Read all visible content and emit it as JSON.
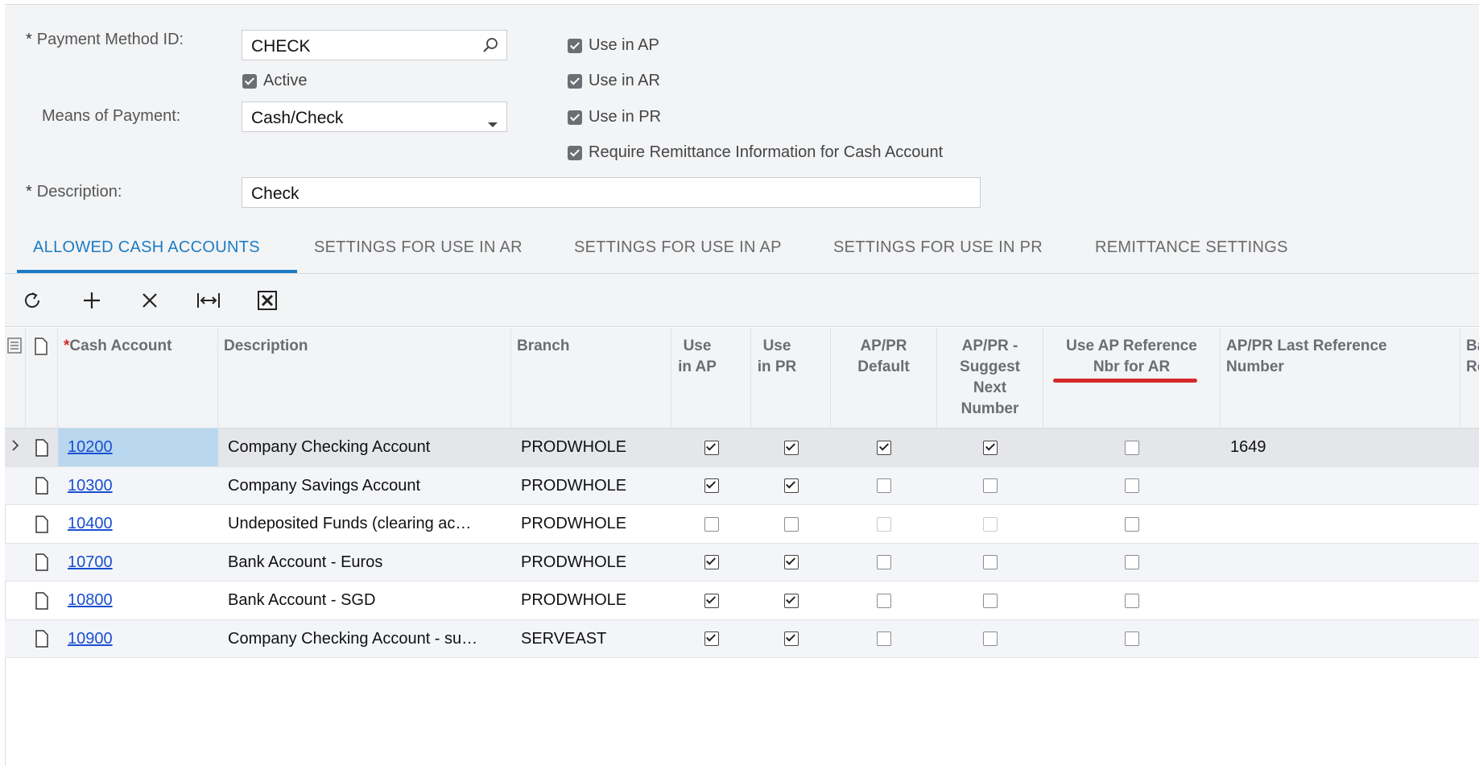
{
  "form": {
    "payment_method_label": "Payment Method ID:",
    "payment_method_value": "CHECK",
    "active_label": "Active",
    "means_label": "Means of Payment:",
    "means_value": "Cash/Check",
    "description_label": "Description:",
    "description_value": "Check",
    "required_mark": "*",
    "checkboxes": [
      {
        "label": "Use in AP",
        "checked": true
      },
      {
        "label": "Use in AR",
        "checked": true
      },
      {
        "label": "Use in PR",
        "checked": true
      },
      {
        "label": "Require Remittance Information for Cash Account",
        "checked": true
      }
    ]
  },
  "tabs": [
    {
      "label": "ALLOWED CASH ACCOUNTS",
      "active": true
    },
    {
      "label": "SETTINGS FOR USE IN AR",
      "active": false
    },
    {
      "label": "SETTINGS FOR USE IN AP",
      "active": false
    },
    {
      "label": "SETTINGS FOR USE IN PR",
      "active": false
    },
    {
      "label": "REMITTANCE SETTINGS",
      "active": false
    }
  ],
  "toolbar": [
    "refresh-icon",
    "add-icon",
    "delete-icon",
    "fit-columns-icon",
    "excel-export-icon"
  ],
  "grid": {
    "headers": {
      "cash_account": "Cash Account",
      "description": "Description",
      "branch": "Branch",
      "use_ap": "Use in AP",
      "use_pr": "Use in PR",
      "appr_default": "AP/PR Default",
      "appr_suggest": "AP/PR - Suggest Next Number",
      "use_ap_ref": "Use AP Reference Nbr for AR",
      "last_ref": "AP/PR Last Reference Number",
      "next_col": "Ba Re"
    },
    "rows": [
      {
        "account": "10200",
        "description": "Company Checking Account",
        "branch": "PRODWHOLE",
        "use_ap": "on",
        "use_pr": "on",
        "default": "on",
        "suggest": "on",
        "use_ap_ref": "off",
        "last_ref": "1649"
      },
      {
        "account": "10300",
        "description": "Company Savings Account",
        "branch": "PRODWHOLE",
        "use_ap": "on",
        "use_pr": "on",
        "default": "off",
        "suggest": "off",
        "use_ap_ref": "off",
        "last_ref": ""
      },
      {
        "account": "10400",
        "description": "Undeposited Funds (clearing ac…",
        "branch": "PRODWHOLE",
        "use_ap": "off",
        "use_pr": "off",
        "default": "dis",
        "suggest": "dis",
        "use_ap_ref": "off",
        "last_ref": ""
      },
      {
        "account": "10700",
        "description": "Bank Account - Euros",
        "branch": "PRODWHOLE",
        "use_ap": "on",
        "use_pr": "on",
        "default": "off",
        "suggest": "off",
        "use_ap_ref": "off",
        "last_ref": ""
      },
      {
        "account": "10800",
        "description": "Bank Account - SGD",
        "branch": "PRODWHOLE",
        "use_ap": "on",
        "use_pr": "on",
        "default": "off",
        "suggest": "off",
        "use_ap_ref": "off",
        "last_ref": ""
      },
      {
        "account": "10900",
        "description": "Company Checking Account - su…",
        "branch": "SERVEAST",
        "use_ap": "on",
        "use_pr": "on",
        "default": "off",
        "suggest": "off",
        "use_ap_ref": "off",
        "last_ref": ""
      }
    ]
  },
  "colors": {
    "accent": "#1b7cc4",
    "link": "#1a4fd0",
    "highlight": "#d42a2a",
    "selected_cell": "#b9d8f0"
  }
}
